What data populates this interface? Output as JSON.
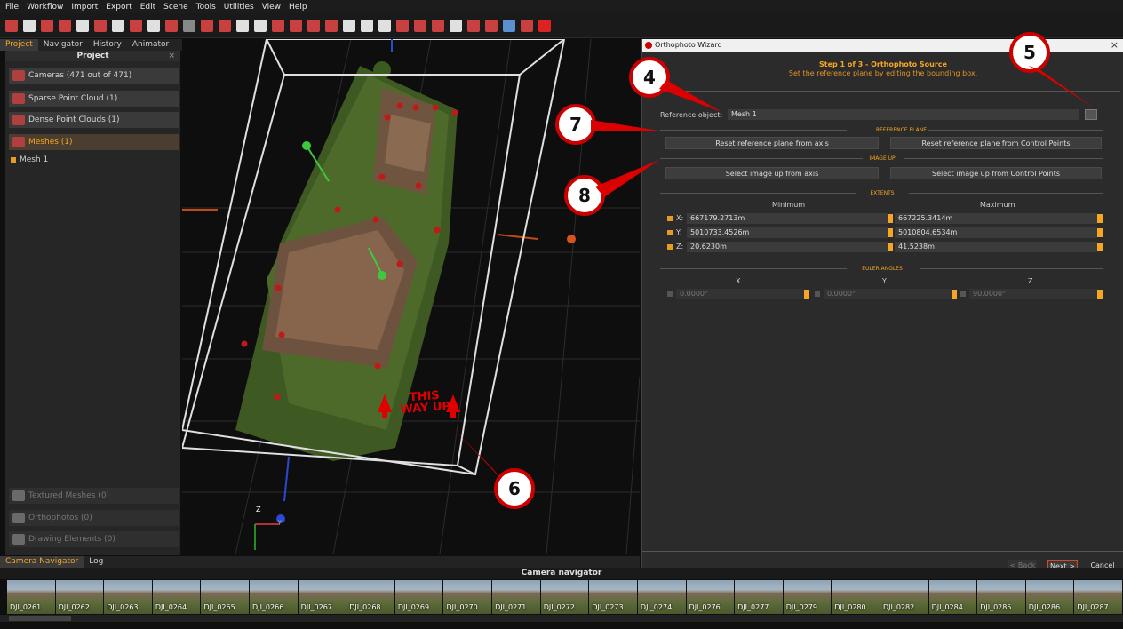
{
  "menu": [
    "File",
    "Workflow",
    "Import",
    "Export",
    "Edit",
    "Scene",
    "Tools",
    "Utilities",
    "View",
    "Help"
  ],
  "left_tabs": [
    "Project",
    "Navigator",
    "History",
    "Animator"
  ],
  "project_panel": {
    "title": "Project",
    "close_glyph": "×",
    "items": [
      {
        "label": "Cameras (471 out of 471)",
        "state": "normal"
      },
      {
        "label": "Sparse Point Cloud (1)",
        "state": "normal"
      },
      {
        "label": "Dense Point Clouds (1)",
        "state": "normal"
      },
      {
        "label": "Meshes (1)",
        "state": "selected"
      }
    ],
    "mesh_child": "Mesh 1",
    "bottom_items": [
      "Textured Meshes (0)",
      "Orthophotos (0)",
      "Drawing Elements (0)"
    ]
  },
  "viewport": {
    "text_line1": "THIS",
    "text_line2": "WAY UP",
    "axis_z": "Z",
    "axis_y": "Y"
  },
  "bottom_tabs": [
    "Camera Navigator",
    "Log"
  ],
  "camera_navigator_title": "Camera navigator",
  "thumbnails": [
    "DJI_0261",
    "DJI_0262",
    "DJI_0263",
    "DJI_0264",
    "DJI_0265",
    "DJI_0266",
    "DJI_0267",
    "DJI_0268",
    "DJI_0269",
    "DJI_0270",
    "DJI_0271",
    "DJI_0272",
    "DJI_0273",
    "DJI_0274",
    "DJI_0276",
    "DJI_0277",
    "DJI_0279",
    "DJI_0280",
    "DJI_0282",
    "DJI_0284",
    "DJI_0285",
    "DJI_0286",
    "DJI_0287"
  ],
  "wizard": {
    "title": "Orthophoto Wizard",
    "close_glyph": "×",
    "step_title": "Step 1 of 3 - Orthophoto Source",
    "step_subtitle": "Set the reference plane by editing the bounding box.",
    "reference_object_label": "Reference object:",
    "reference_object_value": "Mesh 1",
    "reference_plane_section": "REFERENCE PLANE",
    "reset_axis_button": "Reset reference plane from axis",
    "reset_cp_button": "Reset reference plane from Control Points",
    "image_up_section": "IMAGE UP",
    "image_up_axis_button": "Select image up from axis",
    "image_up_cp_button": "Select image up from Control Points",
    "extents_section": "EXTENTS",
    "min_header": "Minimum",
    "max_header": "Maximum",
    "extents": [
      {
        "axis": "X:",
        "min": "667179.2713m",
        "max": "667225.3414m"
      },
      {
        "axis": "Y:",
        "min": "5010733.4526m",
        "max": "5010804.6534m"
      },
      {
        "axis": "Z:",
        "min": "20.6230m",
        "max": "41.5238m"
      }
    ],
    "euler_section": "EULER ANGLES",
    "euler_headers": [
      "X",
      "Y",
      "Z"
    ],
    "euler_values": [
      "0.0000°",
      "0.0000°",
      "90.0000°"
    ],
    "back_button": "< Back",
    "next_button": "Next >",
    "cancel_button": "Cancel"
  },
  "callouts": [
    "4",
    "5",
    "6",
    "7",
    "8"
  ],
  "colors": {
    "accent": "#f5a623",
    "callout_red": "#cc0000",
    "arrow_red": "#e00000"
  }
}
